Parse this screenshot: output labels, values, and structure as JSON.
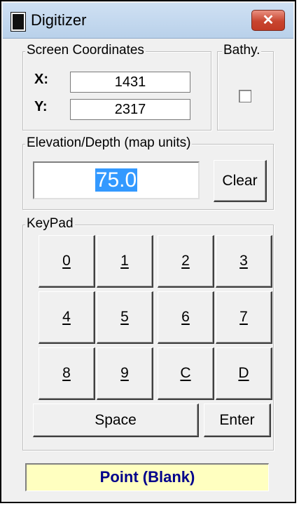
{
  "window": {
    "title": "Digitizer",
    "close_glyph": "✕",
    "icon": "app-window-icon"
  },
  "screen_coordinates": {
    "label": "Screen Coordinates",
    "x_label": "X:",
    "x_value": "1431",
    "y_label": "Y:",
    "y_value": "2317"
  },
  "bathy": {
    "label": "Bathy.",
    "checked": false
  },
  "elevation": {
    "label": "Elevation/Depth (map units)",
    "value": "75.0",
    "clear_label": "Clear"
  },
  "keypad": {
    "label": "KeyPad",
    "keys": [
      "0",
      "1",
      "2",
      "3",
      "4",
      "5",
      "6",
      "7",
      "8",
      "9",
      "C",
      "D"
    ],
    "space_label": "Space",
    "enter_label": "Enter"
  },
  "status": {
    "text": "Point (Blank)"
  },
  "colors": {
    "status_background": "#ffffc0",
    "status_text": "#00008b",
    "selection_highlight": "#3399ff",
    "close_button": "#c8452f"
  }
}
